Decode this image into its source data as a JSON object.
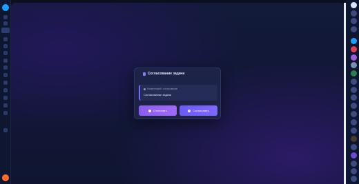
{
  "dialog": {
    "title": "Согласование задачи",
    "hint": "Комментарий к согласованию",
    "info_text": "Согласование задачи",
    "reject_label": "Отклонить",
    "approve_label": "Согласовать"
  },
  "colors": {
    "accent": "#7f68ff",
    "reject": "#a06af5",
    "background": "#0f1531"
  },
  "icons": {
    "title": "task-icon",
    "hint": "info-icon",
    "reject": "close-icon",
    "approve": "check-icon"
  }
}
